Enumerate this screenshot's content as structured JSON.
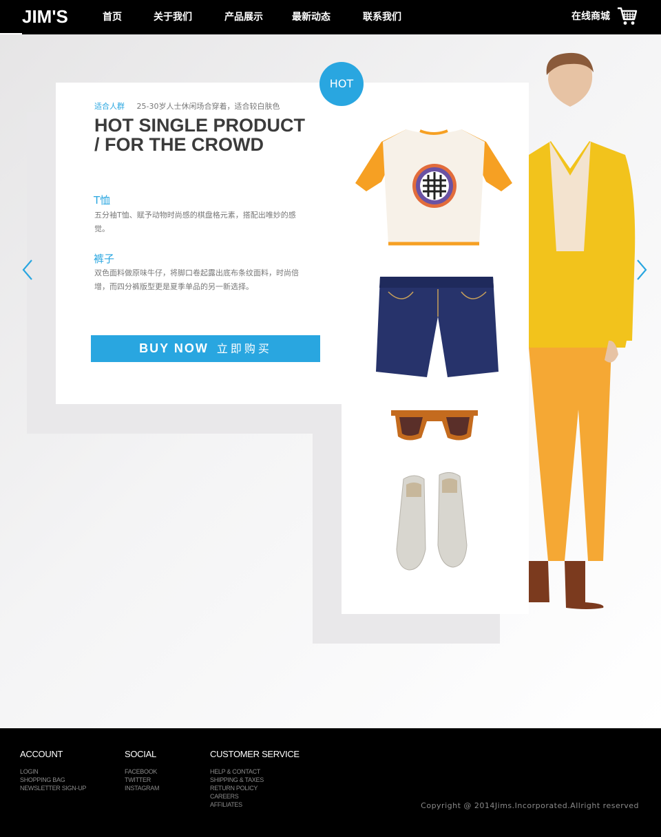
{
  "colors": {
    "accent": "#29a6e0",
    "header_bg": "#000000",
    "headline": "#3b3b3b"
  },
  "header": {
    "logo": "JIM'S",
    "nav": [
      "首页",
      "关于我们",
      "产品展示",
      "最新动态",
      "联系我们"
    ],
    "shop_label": "在线商城",
    "cart_icon": "cart-icon"
  },
  "hero": {
    "badge": "HOT",
    "crowd_key": "适合人群",
    "crowd_value": "25-30岁人士休闲场合穿着，适合较白肤色",
    "headline_line1": "HOT SINGLE PRODUCT",
    "headline_line2": "/ FOR THE CROWD",
    "items": [
      {
        "title": "T恤",
        "desc": "五分袖T恤、赋予动物时尚感的棋盘格元素，搭配出唯妙的感觉。"
      },
      {
        "title": "裤子",
        "desc": "双色面料做原味牛仔，将脚口卷起露出底布条纹面料，时尚倍增，而四分裤版型更是夏季单品的另一新选择。"
      }
    ],
    "buy_en": "BUY NOW",
    "buy_zh": "立即购买",
    "prev_icon": "chevron-left-icon",
    "next_icon": "chevron-right-icon"
  },
  "footer": {
    "columns": [
      {
        "title": "ACCOUNT",
        "links": [
          "LOGIN",
          "SHOPPING BAG",
          "NEWSLETTER SIGN-UP"
        ]
      },
      {
        "title": "SOCIAL",
        "links": [
          "FACEBOOK",
          "TWITTER",
          "INSTAGRAM"
        ]
      },
      {
        "title": "CUSTOMER SERVICE",
        "links": [
          "HELP & CONTACT",
          "SHIPPING & TAXES",
          "RETURN POLICY",
          "CAREERS",
          "AFFILIATES"
        ]
      }
    ],
    "copyright": "Copyright @ 2014Jims.Incorporated.Allright reserved"
  }
}
